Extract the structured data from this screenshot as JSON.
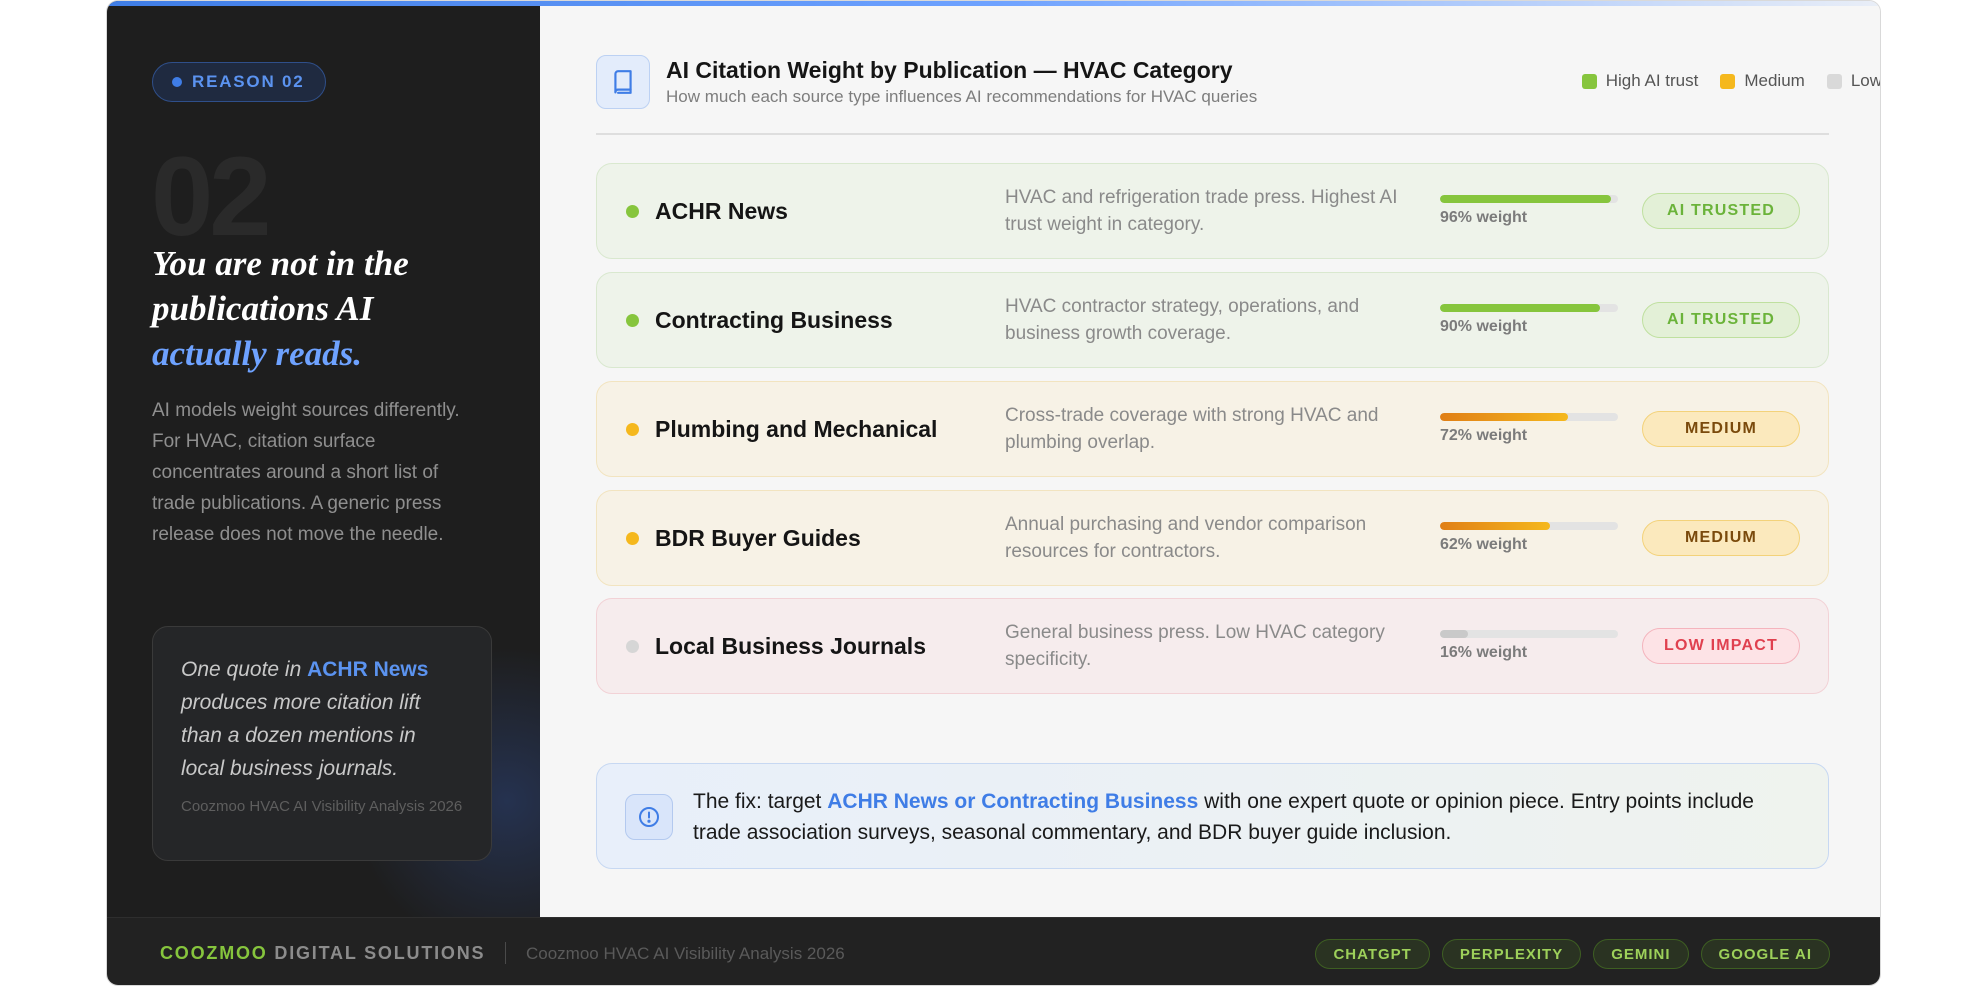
{
  "left": {
    "reason_label": "REASON 02",
    "big_number": "02",
    "headline_line1": "You are not in the",
    "headline_line2": "publications AI",
    "headline_accent": "actually reads.",
    "body": "AI models weight sources differently. For HVAC, citation surface concentrates around a short list of trade publications. A generic press release does not move the needle.",
    "quote": {
      "pre": "One quote in ",
      "highlight": "ACHR News",
      "post": " produces more citation lift than a dozen mentions in local business journals.",
      "source": "Coozmoo HVAC AI Visibility Analysis 2026"
    }
  },
  "header": {
    "title": "AI Citation Weight by Publication — HVAC Category",
    "subtitle": "How much each source type influences AI recommendations for HVAC queries",
    "icon": "book-icon",
    "legend": [
      {
        "label": "High AI trust",
        "color": "#86c53d"
      },
      {
        "label": "Medium",
        "color": "#f5b81d"
      },
      {
        "label": "Low",
        "color": "#d9d9d9"
      }
    ]
  },
  "rows": [
    {
      "name": "ACHR News",
      "description": "HVAC and refrigeration trade press. Highest AI trust weight in category.",
      "weight": 0.96,
      "weight_label": "96% weight",
      "badge": "AI TRUSTED",
      "tier": "green",
      "dot_color": "#86c53d",
      "bar_color": "#86c53d"
    },
    {
      "name": "Contracting Business",
      "description": "HVAC contractor strategy, operations, and business growth coverage.",
      "weight": 0.9,
      "weight_label": "90% weight",
      "badge": "AI TRUSTED",
      "tier": "green",
      "dot_color": "#86c53d",
      "bar_color": "#86c53d"
    },
    {
      "name": "Plumbing and Mechanical",
      "description": "Cross-trade coverage with strong HVAC and plumbing overlap.",
      "weight": 0.72,
      "weight_label": "72% weight",
      "badge": "MEDIUM",
      "tier": "amber",
      "dot_color": "#f5b81d",
      "bar_color": "#e8961a"
    },
    {
      "name": "BDR Buyer Guides",
      "description": "Annual purchasing and vendor comparison resources for contractors.",
      "weight": 0.62,
      "weight_label": "62% weight",
      "badge": "MEDIUM",
      "tier": "amber",
      "dot_color": "#f5b81d",
      "bar_color": "#e8961a"
    },
    {
      "name": "Local Business Journals",
      "description": "General business press. Low HVAC category specificity.",
      "weight": 0.16,
      "weight_label": "16% weight",
      "badge": "LOW IMPACT",
      "tier": "red",
      "dot_color": "#d6d6d6",
      "bar_color": "#c9c9c9"
    }
  ],
  "fix": {
    "pre": "The fix: target ",
    "highlight": "ACHR News or Contracting Business",
    "post": " with one expert quote or opinion piece. Entry points include trade association surveys, seasonal commentary, and BDR buyer guide inclusion."
  },
  "footer": {
    "brand_main": "COOZMOO",
    "brand_rest": " DIGITAL SOLUTIONS",
    "analysis": "Coozmoo HVAC AI Visibility Analysis 2026",
    "chips": [
      "CHATGPT",
      "PERPLEXITY",
      "GEMINI",
      "GOOGLE AI"
    ]
  }
}
